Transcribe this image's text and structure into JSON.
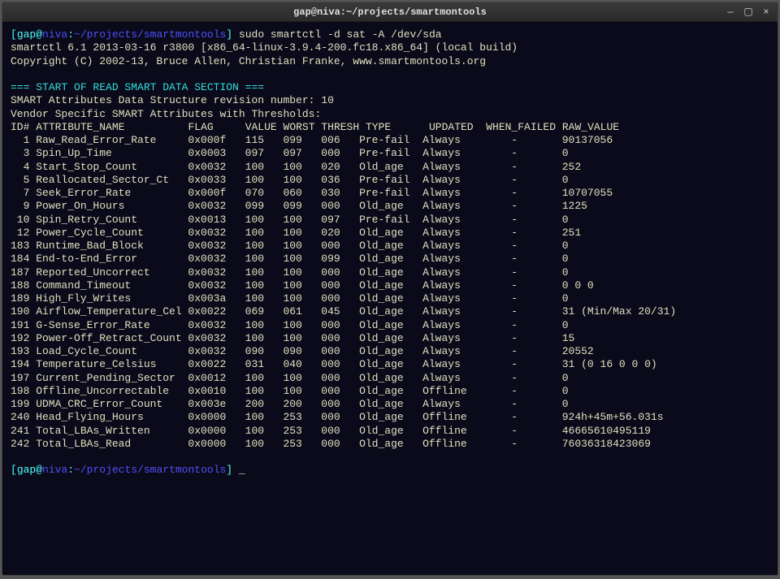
{
  "window": {
    "title": "gap@niva:~/projects/smartmontools"
  },
  "prompt": {
    "user": "gap",
    "host": "niva",
    "path": "~/projects/smartmontools",
    "command": "sudo smartctl -d sat -A /dev/sda"
  },
  "header": {
    "line1": "smartctl 6.1 2013-03-16 r3800 [x86_64-linux-3.9.4-200.fc18.x86_64] (local build)",
    "line2": "Copyright (C) 2002-13, Bruce Allen, Christian Franke, www.smartmontools.org"
  },
  "section": {
    "banner": "=== START OF READ SMART DATA SECTION ===",
    "rev": "SMART Attributes Data Structure revision number: 10",
    "vendor": "Vendor Specific SMART Attributes with Thresholds:"
  },
  "columns": {
    "id": "ID#",
    "name": "ATTRIBUTE_NAME",
    "flag": "FLAG",
    "value": "VALUE",
    "worst": "WORST",
    "thresh": "THRESH",
    "type": "TYPE",
    "updated": "UPDATED",
    "when": "WHEN_FAILED",
    "raw": "RAW_VALUE"
  },
  "rows": [
    {
      "id": "1",
      "name": "Raw_Read_Error_Rate",
      "flag": "0x000f",
      "value": "115",
      "worst": "099",
      "thresh": "006",
      "type": "Pre-fail",
      "updated": "Always",
      "when": "-",
      "raw": "90137056"
    },
    {
      "id": "3",
      "name": "Spin_Up_Time",
      "flag": "0x0003",
      "value": "097",
      "worst": "097",
      "thresh": "000",
      "type": "Pre-fail",
      "updated": "Always",
      "when": "-",
      "raw": "0"
    },
    {
      "id": "4",
      "name": "Start_Stop_Count",
      "flag": "0x0032",
      "value": "100",
      "worst": "100",
      "thresh": "020",
      "type": "Old_age",
      "updated": "Always",
      "when": "-",
      "raw": "252"
    },
    {
      "id": "5",
      "name": "Reallocated_Sector_Ct",
      "flag": "0x0033",
      "value": "100",
      "worst": "100",
      "thresh": "036",
      "type": "Pre-fail",
      "updated": "Always",
      "when": "-",
      "raw": "0"
    },
    {
      "id": "7",
      "name": "Seek_Error_Rate",
      "flag": "0x000f",
      "value": "070",
      "worst": "060",
      "thresh": "030",
      "type": "Pre-fail",
      "updated": "Always",
      "when": "-",
      "raw": "10707055"
    },
    {
      "id": "9",
      "name": "Power_On_Hours",
      "flag": "0x0032",
      "value": "099",
      "worst": "099",
      "thresh": "000",
      "type": "Old_age",
      "updated": "Always",
      "when": "-",
      "raw": "1225"
    },
    {
      "id": "10",
      "name": "Spin_Retry_Count",
      "flag": "0x0013",
      "value": "100",
      "worst": "100",
      "thresh": "097",
      "type": "Pre-fail",
      "updated": "Always",
      "when": "-",
      "raw": "0"
    },
    {
      "id": "12",
      "name": "Power_Cycle_Count",
      "flag": "0x0032",
      "value": "100",
      "worst": "100",
      "thresh": "020",
      "type": "Old_age",
      "updated": "Always",
      "when": "-",
      "raw": "251"
    },
    {
      "id": "183",
      "name": "Runtime_Bad_Block",
      "flag": "0x0032",
      "value": "100",
      "worst": "100",
      "thresh": "000",
      "type": "Old_age",
      "updated": "Always",
      "when": "-",
      "raw": "0"
    },
    {
      "id": "184",
      "name": "End-to-End_Error",
      "flag": "0x0032",
      "value": "100",
      "worst": "100",
      "thresh": "099",
      "type": "Old_age",
      "updated": "Always",
      "when": "-",
      "raw": "0"
    },
    {
      "id": "187",
      "name": "Reported_Uncorrect",
      "flag": "0x0032",
      "value": "100",
      "worst": "100",
      "thresh": "000",
      "type": "Old_age",
      "updated": "Always",
      "when": "-",
      "raw": "0"
    },
    {
      "id": "188",
      "name": "Command_Timeout",
      "flag": "0x0032",
      "value": "100",
      "worst": "100",
      "thresh": "000",
      "type": "Old_age",
      "updated": "Always",
      "when": "-",
      "raw": "0 0 0"
    },
    {
      "id": "189",
      "name": "High_Fly_Writes",
      "flag": "0x003a",
      "value": "100",
      "worst": "100",
      "thresh": "000",
      "type": "Old_age",
      "updated": "Always",
      "when": "-",
      "raw": "0"
    },
    {
      "id": "190",
      "name": "Airflow_Temperature_Cel",
      "flag": "0x0022",
      "value": "069",
      "worst": "061",
      "thresh": "045",
      "type": "Old_age",
      "updated": "Always",
      "when": "-",
      "raw": "31 (Min/Max 20/31)"
    },
    {
      "id": "191",
      "name": "G-Sense_Error_Rate",
      "flag": "0x0032",
      "value": "100",
      "worst": "100",
      "thresh": "000",
      "type": "Old_age",
      "updated": "Always",
      "when": "-",
      "raw": "0"
    },
    {
      "id": "192",
      "name": "Power-Off_Retract_Count",
      "flag": "0x0032",
      "value": "100",
      "worst": "100",
      "thresh": "000",
      "type": "Old_age",
      "updated": "Always",
      "when": "-",
      "raw": "15"
    },
    {
      "id": "193",
      "name": "Load_Cycle_Count",
      "flag": "0x0032",
      "value": "090",
      "worst": "090",
      "thresh": "000",
      "type": "Old_age",
      "updated": "Always",
      "when": "-",
      "raw": "20552"
    },
    {
      "id": "194",
      "name": "Temperature_Celsius",
      "flag": "0x0022",
      "value": "031",
      "worst": "040",
      "thresh": "000",
      "type": "Old_age",
      "updated": "Always",
      "when": "-",
      "raw": "31 (0 16 0 0 0)"
    },
    {
      "id": "197",
      "name": "Current_Pending_Sector",
      "flag": "0x0012",
      "value": "100",
      "worst": "100",
      "thresh": "000",
      "type": "Old_age",
      "updated": "Always",
      "when": "-",
      "raw": "0"
    },
    {
      "id": "198",
      "name": "Offline_Uncorrectable",
      "flag": "0x0010",
      "value": "100",
      "worst": "100",
      "thresh": "000",
      "type": "Old_age",
      "updated": "Offline",
      "when": "-",
      "raw": "0"
    },
    {
      "id": "199",
      "name": "UDMA_CRC_Error_Count",
      "flag": "0x003e",
      "value": "200",
      "worst": "200",
      "thresh": "000",
      "type": "Old_age",
      "updated": "Always",
      "when": "-",
      "raw": "0"
    },
    {
      "id": "240",
      "name": "Head_Flying_Hours",
      "flag": "0x0000",
      "value": "100",
      "worst": "253",
      "thresh": "000",
      "type": "Old_age",
      "updated": "Offline",
      "when": "-",
      "raw": "924h+45m+56.031s"
    },
    {
      "id": "241",
      "name": "Total_LBAs_Written",
      "flag": "0x0000",
      "value": "100",
      "worst": "253",
      "thresh": "000",
      "type": "Old_age",
      "updated": "Offline",
      "when": "-",
      "raw": "46665610495119"
    },
    {
      "id": "242",
      "name": "Total_LBAs_Read",
      "flag": "0x0000",
      "value": "100",
      "worst": "253",
      "thresh": "000",
      "type": "Old_age",
      "updated": "Offline",
      "when": "-",
      "raw": "76036318423069"
    }
  ],
  "prompt2": {
    "cursor": "_"
  }
}
